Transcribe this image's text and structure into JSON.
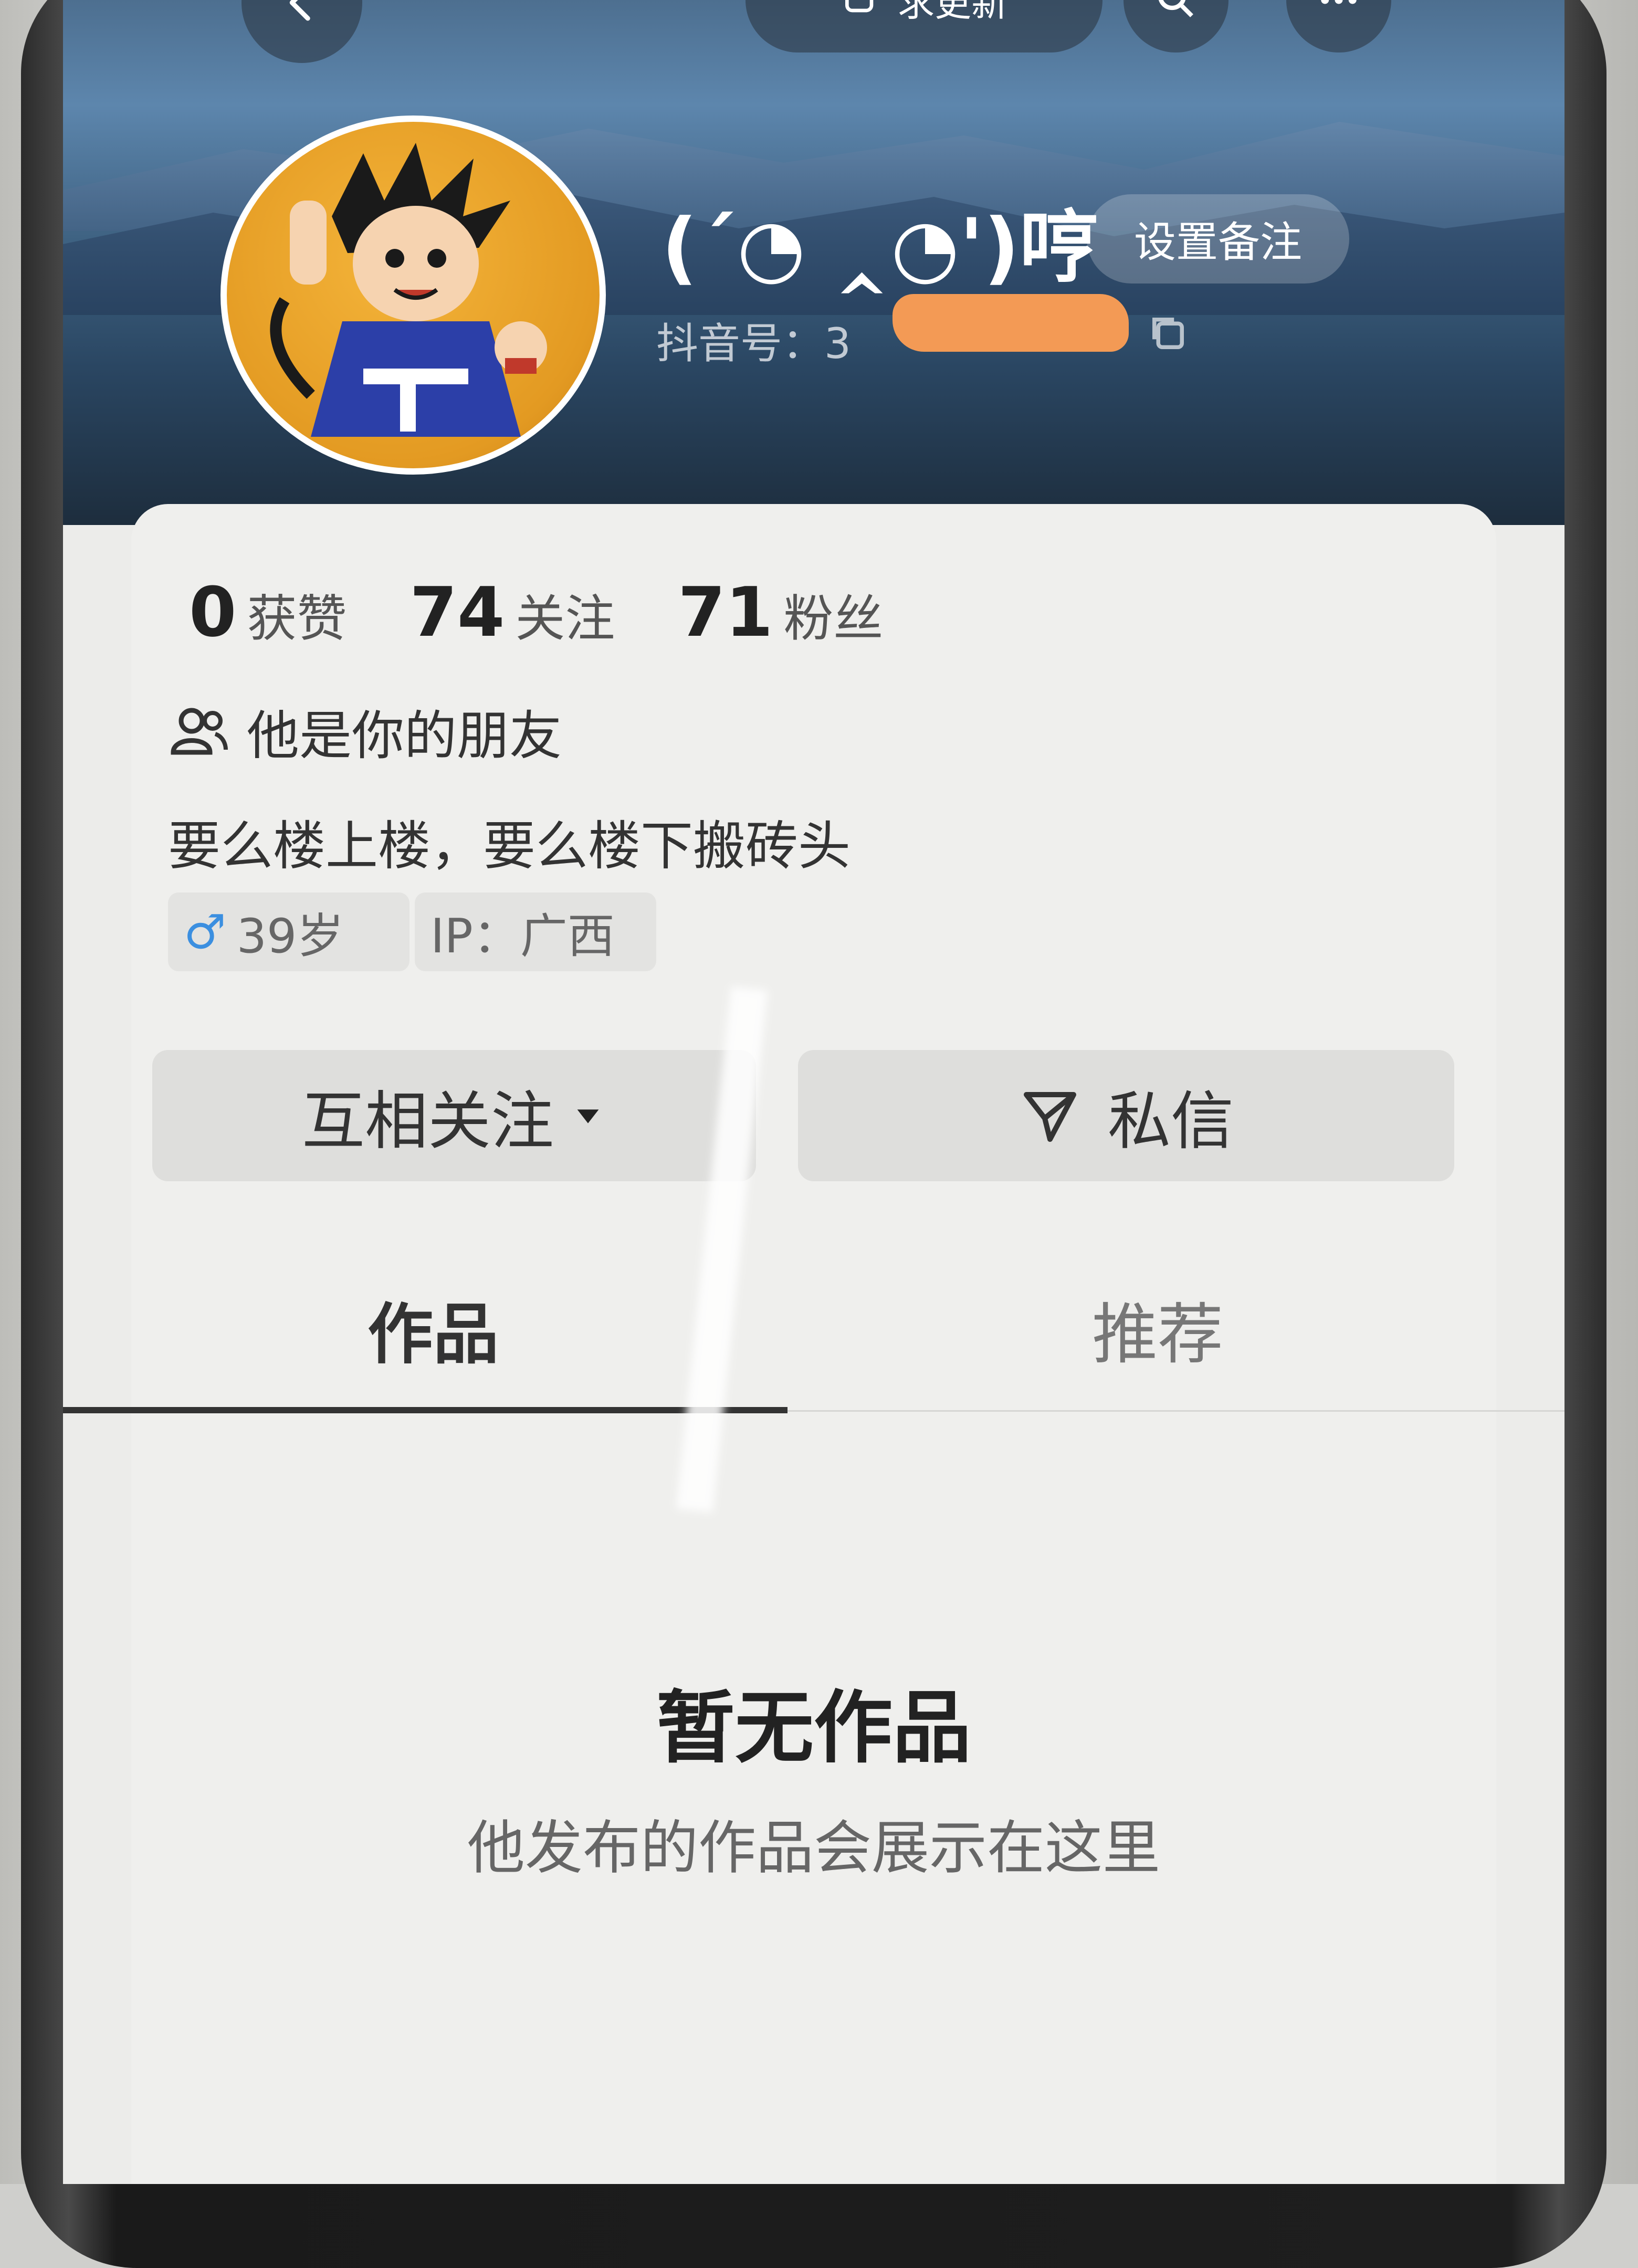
{
  "header": {
    "update_label": "求更新",
    "nickname": "(´◔ ‸◔')哼",
    "remark_button": "设置备注",
    "douyin_id_label": "抖音号：3"
  },
  "stats": [
    {
      "value": "0",
      "label": "获赞"
    },
    {
      "value": "74",
      "label": "关注"
    },
    {
      "value": "71",
      "label": "粉丝"
    }
  ],
  "profile": {
    "friend_text": "他是你的朋友",
    "bio": "要么楼上楼，要么楼下搬砖头",
    "age_tag": "39岁",
    "ip_tag": "IP：广西"
  },
  "actions": {
    "follow_label": "互相关注",
    "message_label": "私信"
  },
  "tabs": {
    "works": "作品",
    "recommend": "推荐"
  },
  "empty_state": {
    "title": "暂无作品",
    "subtitle": "他发布的作品会展示在这里"
  },
  "colors": {
    "redaction": "#f39a55",
    "gender_male": "#3b8fe0"
  }
}
